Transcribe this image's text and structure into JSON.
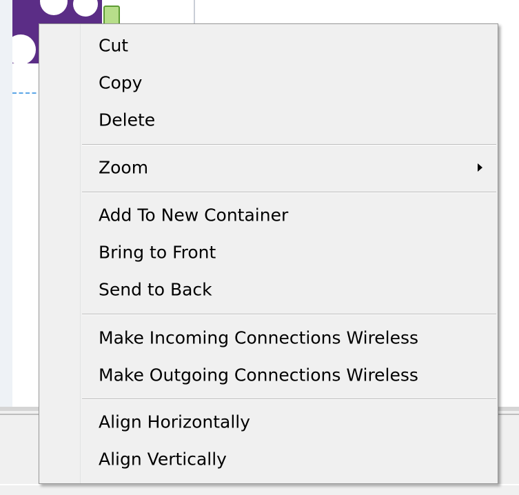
{
  "colors": {
    "menu_background": "#f0f0f0",
    "menu_border": "#979797",
    "node_purple": "#5b2d86",
    "badge_green": "#b7de8a",
    "connection_blue": "#5aa5e6"
  },
  "context_menu": {
    "items": [
      {
        "label": "Cut"
      },
      {
        "label": "Copy"
      },
      {
        "label": "Delete"
      },
      {
        "label": "Zoom",
        "has_submenu": true
      },
      {
        "label": "Add To New Container"
      },
      {
        "label": "Bring to Front"
      },
      {
        "label": "Send to Back"
      },
      {
        "label": "Make Incoming Connections Wireless"
      },
      {
        "label": "Make Outgoing Connections Wireless"
      },
      {
        "label": "Align Horizontally"
      },
      {
        "label": "Align Vertically"
      }
    ],
    "submenu_icon": "chevron-right-icon"
  }
}
